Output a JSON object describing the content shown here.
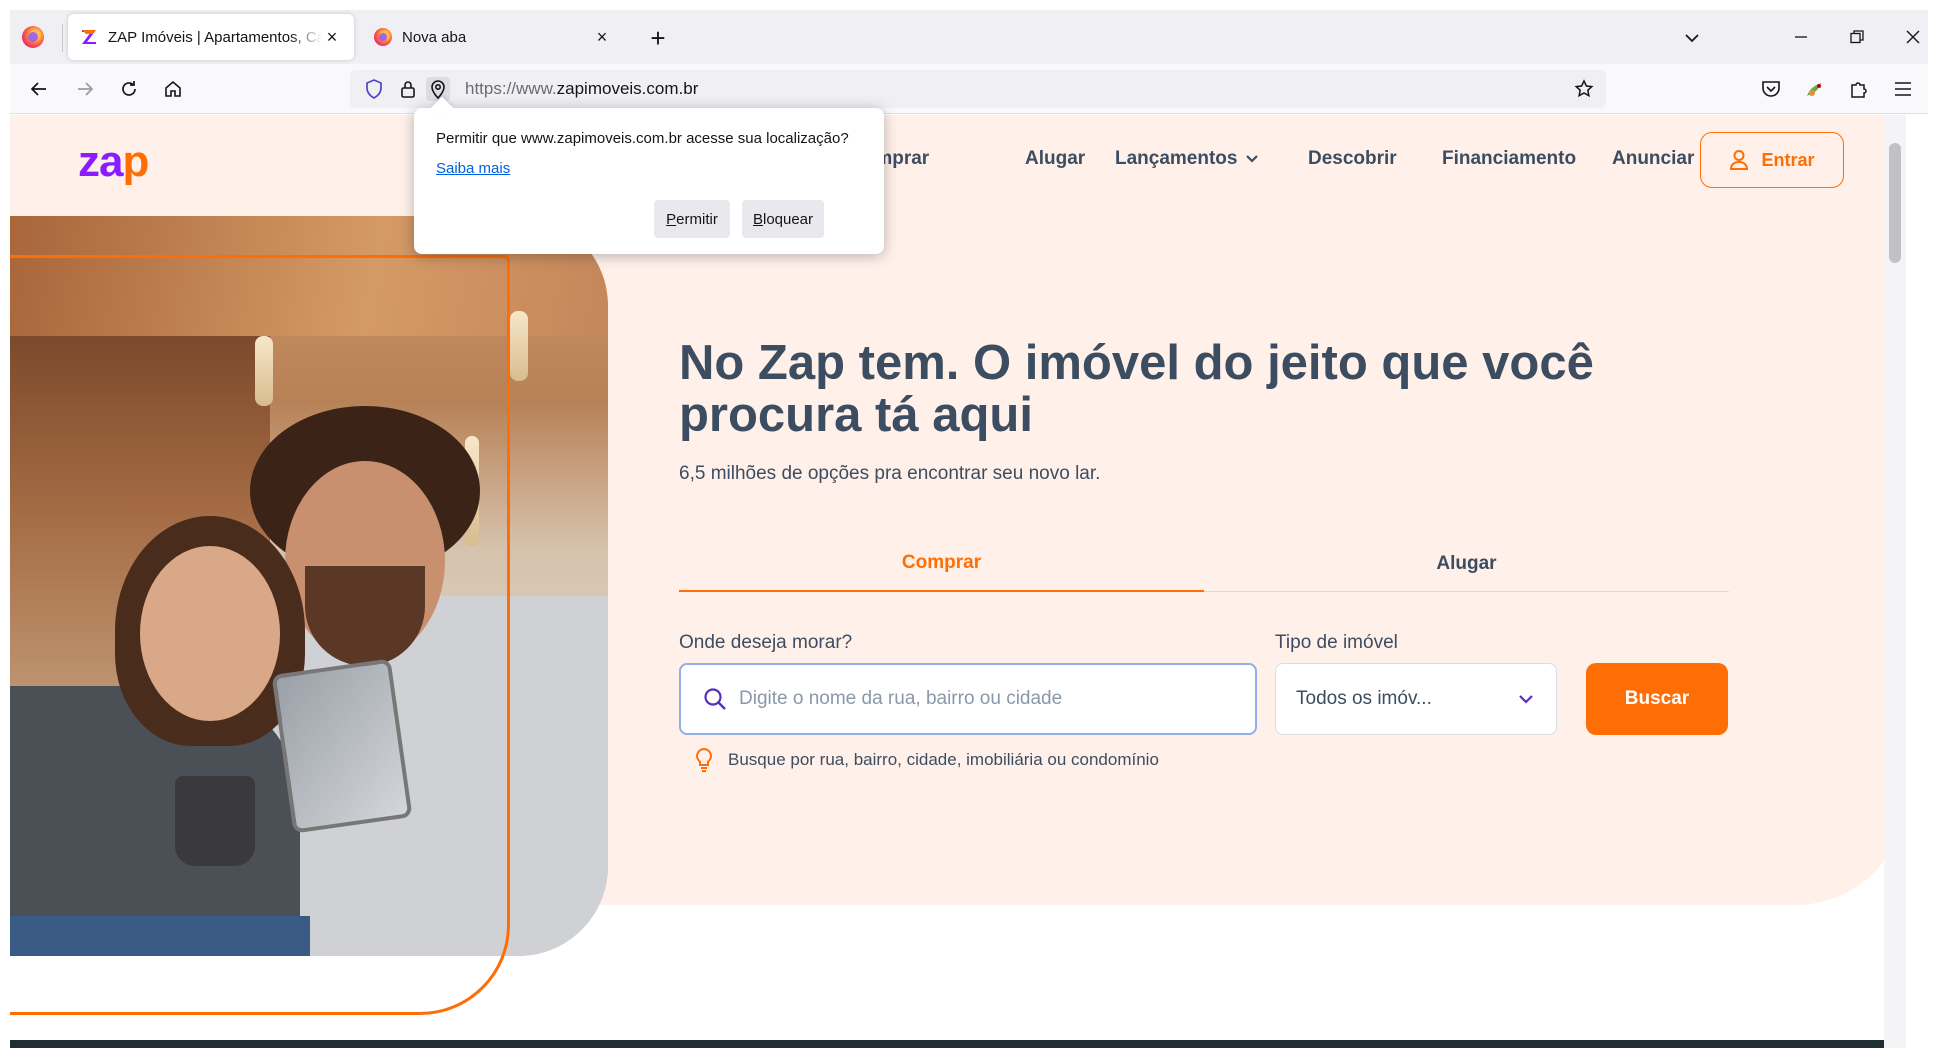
{
  "browser": {
    "tabs": [
      {
        "title": "ZAP Imóveis | Apartamentos, Casas",
        "close": "×"
      },
      {
        "title": "Nova aba",
        "close": "×"
      }
    ],
    "new_tab": "+",
    "url_prefix": "https://www.",
    "url_domain": "zapimoveis.com.br"
  },
  "permission_popup": {
    "message": "Permitir que www.zapimoveis.com.br acesse sua localização?",
    "learn_more": "Saiba mais",
    "allow": "Permitir",
    "block": "Bloquear"
  },
  "site": {
    "logo_main": "za",
    "logo_accent": "p",
    "menu": [
      {
        "label": "Comprar"
      },
      {
        "label": "Alugar"
      },
      {
        "label": "Lançamentos"
      },
      {
        "label": "Descobrir"
      },
      {
        "label": "Financiamento"
      },
      {
        "label": "Anunciar"
      }
    ],
    "login": "Entrar",
    "brand_colors": {
      "orange": "#ff6d05",
      "purple": "#8a1dff"
    }
  },
  "hero": {
    "title": "No Zap tem. O imóvel do jeito que você procura tá aqui",
    "subtitle": "6,5 milhões de opções pra encontrar seu novo lar.",
    "tabs": [
      "Comprar",
      "Alugar"
    ],
    "active_tab": "Comprar",
    "location_label": "Onde deseja morar?",
    "location_placeholder": "Digite o nome da rua, bairro ou cidade",
    "type_label": "Tipo de imóvel",
    "type_value": "Todos os imóv...",
    "search_button": "Buscar",
    "hint": "Busque por rua, bairro, cidade, imobiliária ou condomínio"
  }
}
